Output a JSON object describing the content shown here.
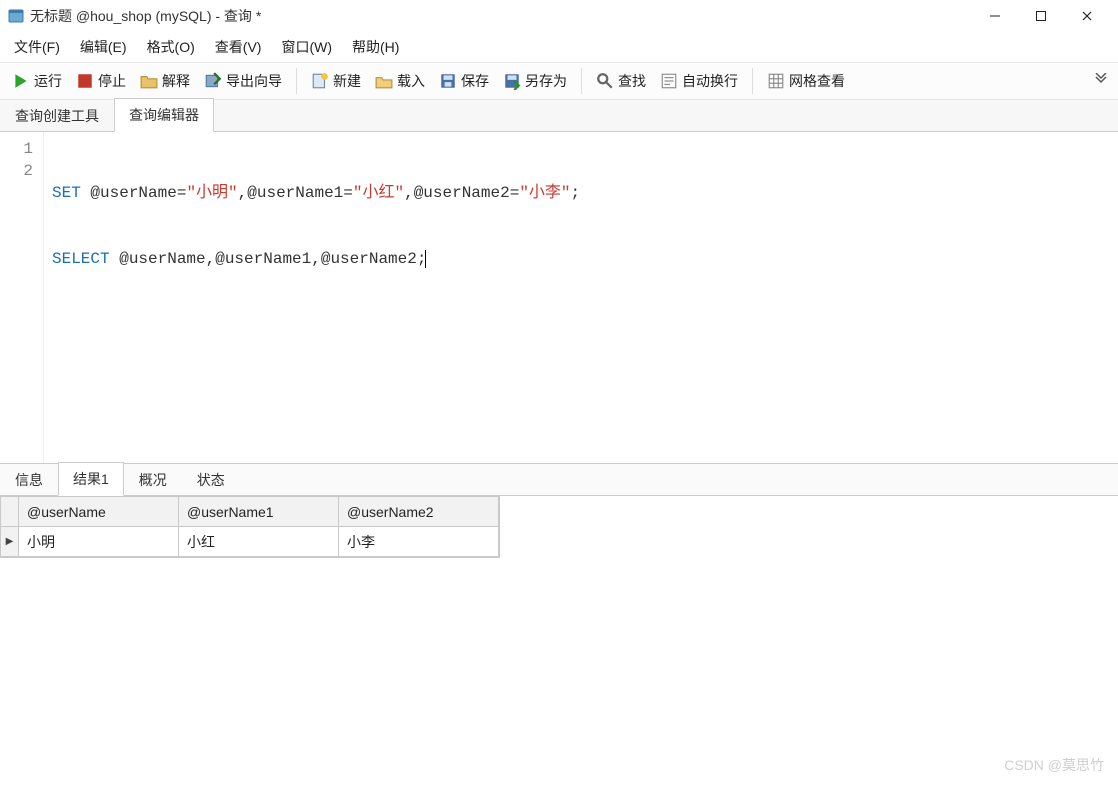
{
  "window": {
    "title": "无标题 @hou_shop (mySQL) - 查询 *"
  },
  "menu": {
    "file": "文件(F)",
    "edit": "编辑(E)",
    "format": "格式(O)",
    "view": "查看(V)",
    "window": "窗口(W)",
    "help": "帮助(H)"
  },
  "toolbar": {
    "run": "运行",
    "stop": "停止",
    "explain": "解释",
    "export_wizard": "导出向导",
    "new": "新建",
    "load": "载入",
    "save": "保存",
    "save_as": "另存为",
    "find": "查找",
    "wrap": "自动换行",
    "grid_view": "网格查看"
  },
  "upper_tabs": {
    "builder": "查询创建工具",
    "editor": "查询编辑器"
  },
  "code": {
    "line1_kw": "SET",
    "line1_rest_a": " @userName=",
    "line1_str1": "\"小明\"",
    "line1_mid1": ",@userName1=",
    "line1_str2": "\"小红\"",
    "line1_mid2": ",@userName2=",
    "line1_str3": "\"小李\"",
    "line1_end": ";",
    "line2_kw": "SELECT",
    "line2_rest": " @userName,@userName1,@userName2;",
    "gutter": [
      "1",
      "2"
    ]
  },
  "lower_tabs": {
    "info": "信息",
    "result1": "结果1",
    "profile": "概况",
    "status": "状态"
  },
  "result": {
    "headers": [
      "@userName",
      "@userName1",
      "@userName2"
    ],
    "rows": [
      [
        "小明",
        "小红",
        "小李"
      ]
    ],
    "row_marker": "▶"
  },
  "watermark": "CSDN @莫思竹"
}
